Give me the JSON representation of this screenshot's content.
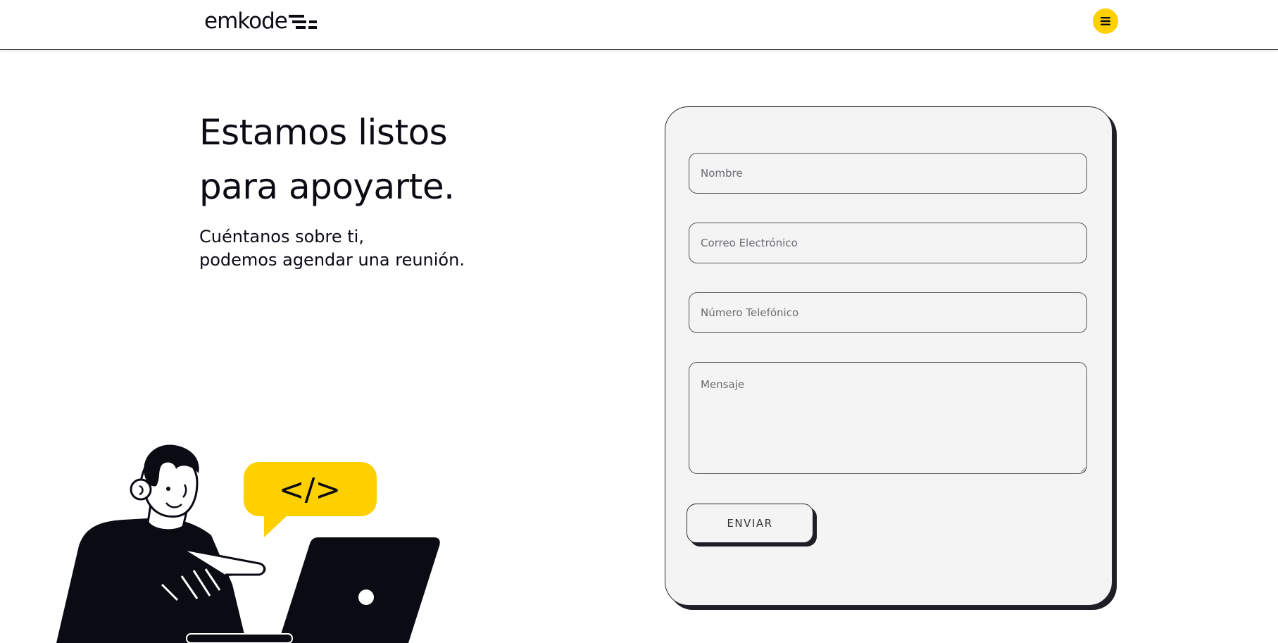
{
  "header": {
    "logo_text": "emkode",
    "logo_icon": "emkode-logo-bars",
    "menu_icon": "hamburger-menu-icon",
    "accent_color": "#ffd000"
  },
  "hero": {
    "title_line_1": "Estamos listos",
    "title_line_2": "para apoyarte.",
    "subtitle_line_1": "Cuéntanos sobre ti,",
    "subtitle_line_2": "podemos agendar una reunión."
  },
  "illustration": {
    "speech_bubble_text": "</>",
    "bubble_color": "#ffd000"
  },
  "form": {
    "name_placeholder": "Nombre",
    "email_placeholder": "Correo Electrónico",
    "phone_placeholder": "Número Telefónico",
    "message_placeholder": "Mensaje",
    "submit_label": "ENVIAR"
  }
}
